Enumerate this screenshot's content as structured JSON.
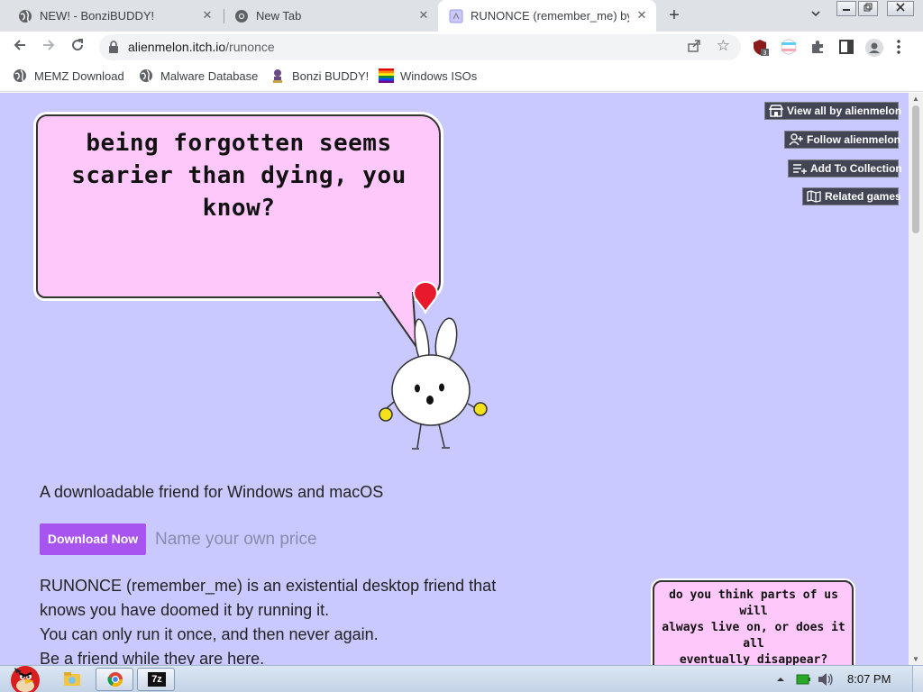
{
  "tabs": [
    {
      "title": "NEW! - BonziBUDDY!",
      "close": "✕"
    },
    {
      "title": "New Tab",
      "close": "✕"
    },
    {
      "title": "RUNONCE (remember_me) by",
      "close": "✕"
    }
  ],
  "newtab_symbol": "+",
  "toolbar": {
    "url_host": "alienmelon.itch.io",
    "url_path": "/runonce",
    "extension_badge": "3"
  },
  "bookmarks": [
    {
      "label": "MEMZ Download"
    },
    {
      "label": "Malware Database"
    },
    {
      "label": "Bonzi BUDDY!"
    },
    {
      "label": "Windows ISOs"
    }
  ],
  "page": {
    "bubble_text": [
      "being forgotten seems",
      "scarier than dying, you",
      "know?"
    ],
    "actions": [
      {
        "label": "View all by alienmelon"
      },
      {
        "label": "Follow alienmelon"
      },
      {
        "label": "Add To Collection"
      },
      {
        "label": "Related games"
      }
    ],
    "tagline": "A downloadable friend for Windows and macOS",
    "download_label": "Download Now",
    "price_placeholder": "Name your own price",
    "description": [
      "RUNONCE (remember_me) is an existential desktop friend that",
      "knows you have doomed it by running it.",
      "You can only run it once, and then never again.",
      "Be a friend while they are here."
    ],
    "small_bubble_text": [
      "do you think parts of us will",
      "always live on, or does it all",
      "eventually disappear?"
    ]
  },
  "taskbar": {
    "clock": "8:07 PM",
    "seven_zip_label": "7z"
  },
  "colors": {
    "page_bg": "#c9c9ff",
    "bubble_fill": "#ffc8fa",
    "download_button": "#a854f0",
    "action_button": "#424554"
  }
}
